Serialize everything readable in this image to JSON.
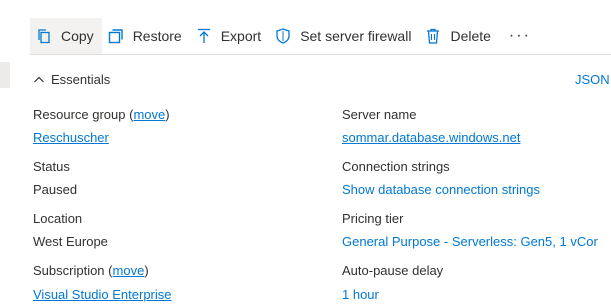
{
  "toolbar": {
    "copy_label": "Copy",
    "restore_label": "Restore",
    "export_label": "Export",
    "firewall_label": "Set server firewall",
    "delete_label": "Delete",
    "more_label": "···"
  },
  "essentials": {
    "header": "Essentials",
    "json_link": "JSON",
    "left": {
      "resource_group_label": "Resource group",
      "resource_group_paren_open": "(",
      "resource_group_move": "move",
      "resource_group_paren_close": ")",
      "resource_group_value": "Reschuscher",
      "status_label": "Status",
      "status_value": "Paused",
      "location_label": "Location",
      "location_value": "West Europe",
      "subscription_label": "Subscription",
      "subscription_paren_open": "(",
      "subscription_move": "move",
      "subscription_paren_close": ")",
      "subscription_value": "Visual Studio Enterprise"
    },
    "right": {
      "server_name_label": "Server name",
      "server_name_value": "sommar.database.windows.net",
      "connection_strings_label": "Connection strings",
      "connection_strings_value": "Show database connection strings",
      "pricing_tier_label": "Pricing tier",
      "pricing_tier_value": "General Purpose - Serverless: Gen5, 1 vCor",
      "auto_pause_label": "Auto-pause delay",
      "auto_pause_value": "1 hour"
    }
  },
  "colors": {
    "accent": "#0078d4",
    "text": "#323130",
    "toolbar_active_bg": "#f3f2f1"
  }
}
